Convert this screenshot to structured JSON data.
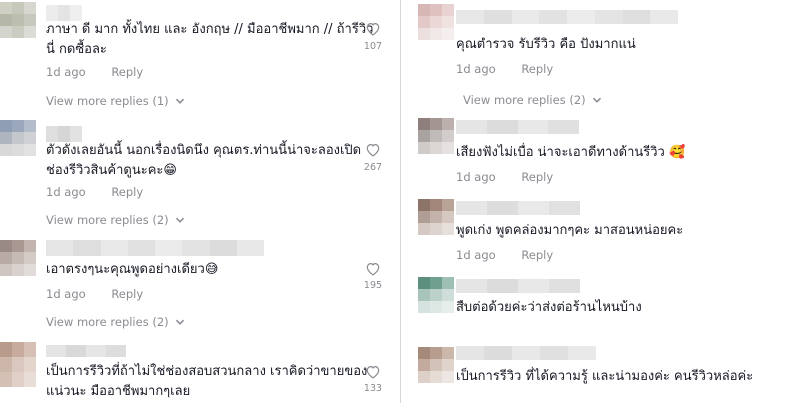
{
  "left_comments": [
    {
      "text": [
        "ภาษา ดี มาก ทั้งไทย และ อังกฤษ // มืออาชีพมาก // ถ้ารีวิว",
        "นี่ กดซื้อละ"
      ],
      "time": "1d ago",
      "reply": "Reply",
      "likes": "107",
      "view_more": "View more replies (1)"
    },
    {
      "text": [
        "ตัวดังเลยอันนี้ นอกเรื่องนิดนึง คุณตร.ท่านนี้น่าจะลองเปิด",
        "ช่องรีวิวสินค้าดูนะคะ😁"
      ],
      "time": "1d ago",
      "reply": "Reply",
      "likes": "267",
      "view_more": "View more replies (2)"
    },
    {
      "text": [
        "เอาตรงๆนะคุณพูดอย่างเดียว😅"
      ],
      "time": "1d ago",
      "reply": "Reply",
      "likes": "195",
      "view_more": "View more replies (2)"
    },
    {
      "text": [
        "เป็นการรีวิวที่ถ้าไม่ใช่ช่องสอบสวนกลาง เราคิดว่าขายของ",
        "แน่วนะ มืออาชีพมากๆเลย"
      ],
      "time": "",
      "reply": "",
      "likes": "133",
      "view_more": ""
    }
  ],
  "right_comments": [
    {
      "text": [
        "คุณตำรวจ รับรีวิว คือ ปังมากแน่"
      ],
      "time": "1d ago",
      "reply": "Reply",
      "view_more": "View more replies (2)"
    },
    {
      "text": [
        "เสียงฟังไม่เบื่อ น่าจะเอาดีทางด้านรีวิว 🥰"
      ],
      "time": "1d ago",
      "reply": "Reply",
      "view_more": ""
    },
    {
      "text": [
        "พูดเก่ง พูดคล่องมากๆคะ มาสอนหน่อยคะ"
      ],
      "time": "1d ago",
      "reply": "Reply",
      "view_more": ""
    },
    {
      "text": [
        "สืบต่อด้วยค่ะว่าส่งต่อร้านไหนบ้าง"
      ],
      "time": "",
      "reply": "",
      "view_more": ""
    },
    {
      "text": [
        "เป็นการรีวิว ที่ได้ความรู้ และน่ามองค่ะ คนรีวิวหล่อค่ะ"
      ],
      "time": "",
      "reply": "",
      "view_more": ""
    }
  ],
  "colors": {
    "text": "#161823",
    "muted": "#8a8b91",
    "divider": "#d6d6d6"
  },
  "icons": {
    "like": "heart-outline-icon",
    "expand": "chevron-down-icon"
  }
}
